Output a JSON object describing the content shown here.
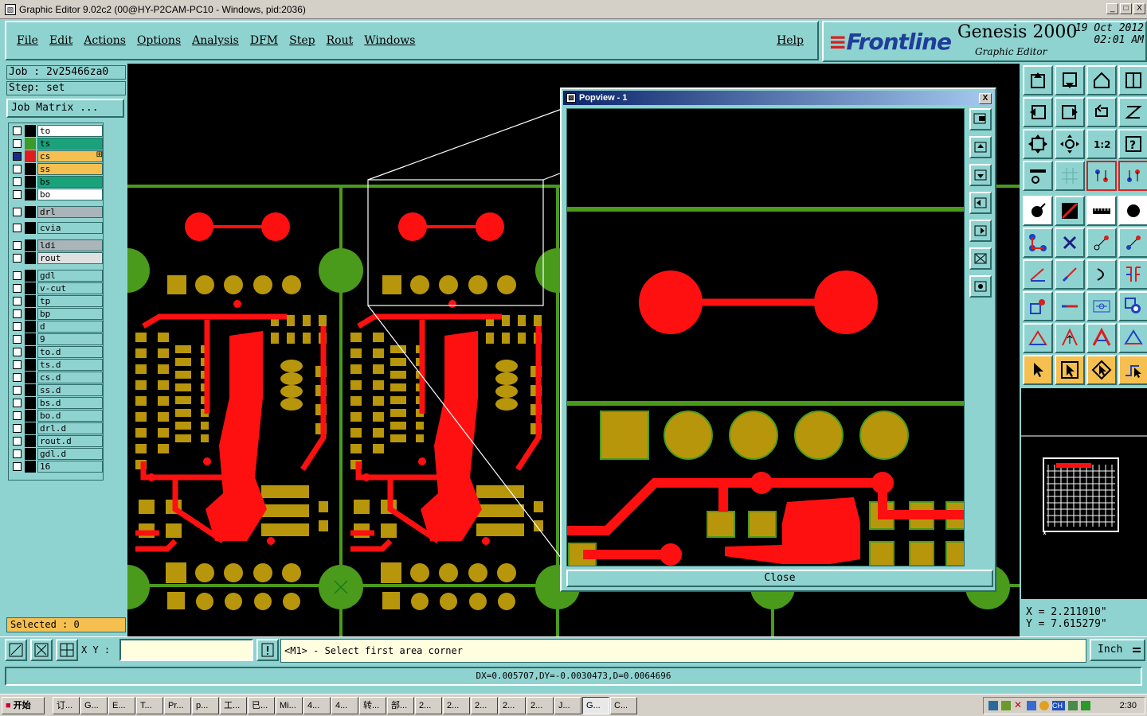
{
  "window": {
    "title": "Graphic Editor 9.02c2 (00@HY-P2CAM-PC10 - Windows, pid:2036)",
    "min": "_",
    "max": "□",
    "close": "X"
  },
  "menu": [
    {
      "label": "File"
    },
    {
      "label": "Edit"
    },
    {
      "label": "Actions"
    },
    {
      "label": "Options"
    },
    {
      "label": "Analysis"
    },
    {
      "label": "DFM"
    },
    {
      "label": "Step"
    },
    {
      "label": "Rout"
    },
    {
      "label": "Windows"
    }
  ],
  "help_label": "Help",
  "brand": {
    "logo": "Frontline",
    "product": "Genesis 2000",
    "subtitle": "Graphic Editor",
    "date_line1": "19 Oct 2012",
    "date_line2": "02:01 AM"
  },
  "job": "Job : 2v25466za0",
  "step": "Step: set",
  "job_matrix": "Job Matrix ...",
  "layers": [
    {
      "name": "to",
      "swatch": "#000000",
      "bg": "#ffffff",
      "checked": false
    },
    {
      "name": "ts",
      "swatch": "#3a9a2a",
      "bg": "#1aa27a",
      "checked": false
    },
    {
      "name": "cs",
      "swatch": "#e21c1c",
      "bg": "#f5c050",
      "checked": true,
      "mark": "⊞"
    },
    {
      "name": "ss",
      "swatch": "#000000",
      "bg": "#f5c050",
      "checked": false
    },
    {
      "name": "bs",
      "swatch": "#000000",
      "bg": "#1aa27a",
      "checked": false
    },
    {
      "name": "bo",
      "swatch": "#000000",
      "bg": "#ffffff",
      "checked": false
    },
    {
      "name": "drl",
      "swatch": "#000000",
      "bg": "#a9b5b8",
      "checked": false
    },
    {
      "name": "cvia",
      "swatch": "#000000",
      "bg": "#8fd3d0",
      "checked": false
    },
    {
      "name": "ldi",
      "swatch": "#000000",
      "bg": "#a9b5b8",
      "checked": false
    },
    {
      "name": "rout",
      "swatch": "#000000",
      "bg": "#e0e0e0",
      "checked": false
    },
    {
      "name": "gdl",
      "swatch": "#000000",
      "bg": "#8fd3d0",
      "checked": false
    },
    {
      "name": "v-cut",
      "swatch": "#000000",
      "bg": "#8fd3d0",
      "checked": false
    },
    {
      "name": "tp",
      "swatch": "#000000",
      "bg": "#8fd3d0",
      "checked": false
    },
    {
      "name": "bp",
      "swatch": "#000000",
      "bg": "#8fd3d0",
      "checked": false
    },
    {
      "name": "d",
      "swatch": "#000000",
      "bg": "#8fd3d0",
      "checked": false
    },
    {
      "name": "9",
      "swatch": "#000000",
      "bg": "#8fd3d0",
      "checked": false
    },
    {
      "name": "to.d",
      "swatch": "#000000",
      "bg": "#8fd3d0",
      "checked": false
    },
    {
      "name": "ts.d",
      "swatch": "#000000",
      "bg": "#8fd3d0",
      "checked": false
    },
    {
      "name": "cs.d",
      "swatch": "#000000",
      "bg": "#8fd3d0",
      "checked": false
    },
    {
      "name": "ss.d",
      "swatch": "#000000",
      "bg": "#8fd3d0",
      "checked": false
    },
    {
      "name": "bs.d",
      "swatch": "#000000",
      "bg": "#8fd3d0",
      "checked": false
    },
    {
      "name": "bo.d",
      "swatch": "#000000",
      "bg": "#8fd3d0",
      "checked": false
    },
    {
      "name": "drl.d",
      "swatch": "#000000",
      "bg": "#8fd3d0",
      "checked": false
    },
    {
      "name": "rout.d",
      "swatch": "#000000",
      "bg": "#8fd3d0",
      "checked": false
    },
    {
      "name": "gdl.d",
      "swatch": "#000000",
      "bg": "#8fd3d0",
      "checked": false
    },
    {
      "name": "16",
      "swatch": "#000000",
      "bg": "#8fd3d0",
      "checked": false
    }
  ],
  "selected": "Selected : 0",
  "popview": {
    "title": "Popview - 1",
    "close_label": "Close"
  },
  "coords": {
    "x": "X = 2.211010\"",
    "y": "Y = 7.615279\""
  },
  "xy_label": "X Y :",
  "xy_value": "",
  "prompt": "<M1> - Select first area corner",
  "units": "Inch",
  "status": "DX=0.005707,DY=-0.0030473,D=0.0064696",
  "taskbar": {
    "start": "开始",
    "tasks": [
      "订...",
      "G...",
      "E...",
      "T...",
      "Pr...",
      "p...",
      "工...",
      "已...",
      "Mi...",
      "4...",
      "4...",
      "转...",
      "部...",
      "2...",
      "2...",
      "2...",
      "2...",
      "2...",
      "J...",
      "G...",
      "C..."
    ],
    "active_index": 19,
    "tray_lang": "CH",
    "clock": "2:30"
  },
  "colors": {
    "bg": "#8fd3d0",
    "copper": "#b8960c",
    "red": "#ff1010",
    "green": "#4a9a1c"
  }
}
